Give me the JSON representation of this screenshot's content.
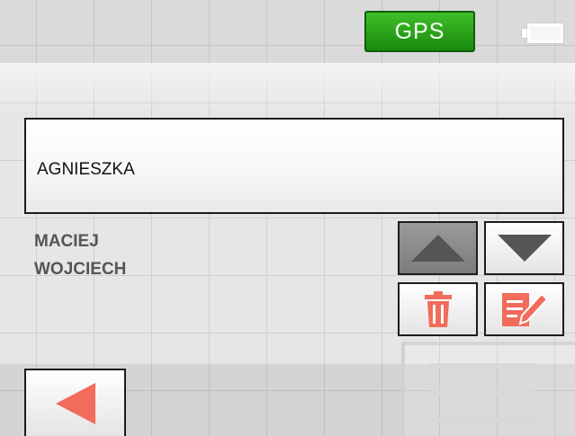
{
  "status_bar": {
    "gps_label": "GPS",
    "gps_color": "#2aa21a",
    "battery_icon": "battery-icon"
  },
  "input": {
    "value": "AGNIESZKA"
  },
  "suggestions": [
    {
      "label": "MACIEJ"
    },
    {
      "label": "WOJCIECH"
    }
  ],
  "controls": {
    "up_icon": "arrow-up-icon",
    "down_icon": "arrow-down-icon",
    "delete_icon": "trash-icon",
    "edit_icon": "edit-note-icon",
    "back_icon": "back-arrow-icon",
    "accent_color": "#f26b5b"
  }
}
